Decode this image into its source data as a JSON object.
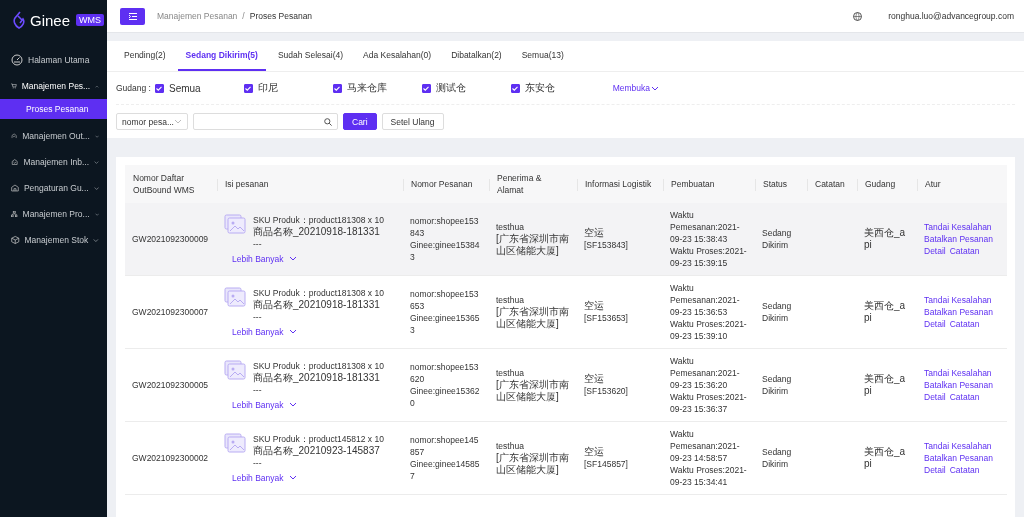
{
  "sidebar": {
    "logo_text": "Ginee",
    "logo_badge": "WMS",
    "items": [
      {
        "label": "Halaman Utama",
        "kind": "link"
      },
      {
        "label": "Manajemen Pes...",
        "kind": "group",
        "expanded": true,
        "children": [
          {
            "label": "Proses Pesanan",
            "selected": true
          }
        ]
      },
      {
        "label": "Manajemen Out...",
        "kind": "group",
        "expanded": false
      },
      {
        "label": "Manajemen Inb...",
        "kind": "group",
        "expanded": false
      },
      {
        "label": "Pengaturan Gu...",
        "kind": "group",
        "expanded": false
      },
      {
        "label": "Manajemen Pro...",
        "kind": "group",
        "expanded": false
      },
      {
        "label": "Manajemen Stok",
        "kind": "group",
        "expanded": false
      }
    ]
  },
  "topbar": {
    "breadcrumb": [
      "Manajemen Pesanan",
      "Proses Pesanan"
    ],
    "breadcrumb_separator": "/",
    "user": "ronghua.luo@advancegroup.com"
  },
  "tabs": [
    {
      "label": "Pending(2)",
      "selected": false
    },
    {
      "label": "Sedang Dikirim(5)",
      "selected": true
    },
    {
      "label": "Sudah Selesai(4)",
      "selected": false
    },
    {
      "label": "Ada Kesalahan(0)",
      "selected": false
    },
    {
      "label": "Dibatalkan(2)",
      "selected": false
    },
    {
      "label": "Semua(13)",
      "selected": false
    }
  ],
  "filter": {
    "label": "Gudang :",
    "options": [
      {
        "label": "Semua",
        "checked": true
      },
      {
        "label": "印尼",
        "checked": true
      },
      {
        "label": "马来仓库",
        "checked": true
      },
      {
        "label": "测试仓",
        "checked": true
      },
      {
        "label": "东安仓",
        "checked": true
      }
    ],
    "expand_link": "Membuka"
  },
  "search": {
    "field_type": "nomor pesa...",
    "buttons": [
      "Cari",
      "Setel Ulang"
    ]
  },
  "table": {
    "columns": [
      "Nomor Daftar OutBound WMS",
      "Isi pesanan",
      "Nomor Pesanan",
      "Penerima & Alamat",
      "Informasi Logistik",
      "Pembuatan",
      "Status",
      "Catatan",
      "Gudang",
      "Atur"
    ],
    "rows": [
      {
        "highlighted": true,
        "wms_no": "GW2021092300009",
        "sku": "SKU Produk：product181308 x 10",
        "product_name": "商品名称_20210918-181331",
        "extra": "---",
        "more": "Lebih Banyak",
        "order_no": "nomor:shopee153843",
        "ginee_no": "Ginee:ginee153843",
        "recipient": "testhua",
        "address": "[广东省深圳市南山区储能大厦]",
        "logistics": "空运",
        "tracking": "[SF153843]",
        "order_time": "Waktu Pemesanan:2021-09-23 15:38:43",
        "process_time": "Waktu Proses:2021-09-23 15:39:15",
        "status": "Sedang Dikirim",
        "warehouse": "美西仓_api",
        "actions": [
          "Tandai Kesalahan",
          "Batalkan Pesanan",
          "Detail",
          "Catatan"
        ]
      },
      {
        "highlighted": false,
        "wms_no": "GW2021092300007",
        "sku": "SKU Produk：product181308 x 10",
        "product_name": "商品名称_20210918-181331",
        "extra": "---",
        "more": "Lebih Banyak",
        "order_no": "nomor:shopee153653",
        "ginee_no": "Ginee:ginee153653",
        "recipient": "testhua",
        "address": "[广东省深圳市南山区储能大厦]",
        "logistics": "空运",
        "tracking": "[SF153653]",
        "order_time": "Waktu Pemesanan:2021-09-23 15:36:53",
        "process_time": "Waktu Proses:2021-09-23 15:39:10",
        "status": "Sedang Dikirim",
        "warehouse": "美西仓_api",
        "actions": [
          "Tandai Kesalahan",
          "Batalkan Pesanan",
          "Detail",
          "Catatan"
        ]
      },
      {
        "highlighted": false,
        "wms_no": "GW2021092300005",
        "sku": "SKU Produk：product181308 x 10",
        "product_name": "商品名称_20210918-181331",
        "extra": "---",
        "more": "Lebih Banyak",
        "order_no": "nomor:shopee153620",
        "ginee_no": "Ginee:ginee153620",
        "recipient": "testhua",
        "address": "[广东省深圳市南山区储能大厦]",
        "logistics": "空运",
        "tracking": "[SF153620]",
        "order_time": "Waktu Pemesanan:2021-09-23 15:36:20",
        "process_time": "Waktu Proses:2021-09-23 15:36:37",
        "status": "Sedang Dikirim",
        "warehouse": "美西仓_api",
        "actions": [
          "Tandai Kesalahan",
          "Batalkan Pesanan",
          "Detail",
          "Catatan"
        ]
      },
      {
        "highlighted": false,
        "wms_no": "GW2021092300002",
        "sku": "SKU Produk：product145812 x 10",
        "product_name": "商品名称_20210923-145837",
        "extra": "---",
        "more": "Lebih Banyak",
        "order_no": "nomor:shopee145857",
        "ginee_no": "Ginee:ginee145857",
        "recipient": "testhua",
        "address": "[广东省深圳市南山区储能大厦]",
        "logistics": "空运",
        "tracking": "[SF145857]",
        "order_time": "Waktu Pemesanan:2021-09-23 14:58:57",
        "process_time": "Waktu Proses:2021-09-23 15:34:41",
        "status": "Sedang Dikirim",
        "warehouse": "美西仓_api",
        "actions": [
          "Tandai Kesalahan",
          "Batalkan Pesanan",
          "Detail",
          "Catatan"
        ]
      }
    ]
  }
}
